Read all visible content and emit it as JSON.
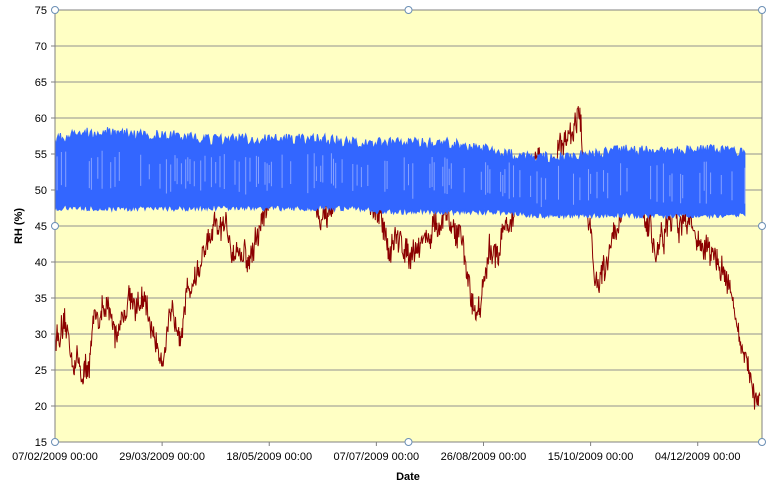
{
  "chart_data": {
    "type": "line",
    "title": "",
    "xlabel": "Date",
    "ylabel": "RH (%)",
    "ylim": [
      15,
      75
    ],
    "y_ticks": [
      15,
      20,
      25,
      30,
      35,
      40,
      45,
      50,
      55,
      60,
      65,
      70,
      75
    ],
    "x_range": [
      "2009-02-07",
      "2010-01-03"
    ],
    "x_ticks": [
      {
        "date": "2009-02-07",
        "label": "07/02/2009 00:00"
      },
      {
        "date": "2009-03-29",
        "label": "29/03/2009 00:00"
      },
      {
        "date": "2009-05-18",
        "label": "18/05/2009 00:00"
      },
      {
        "date": "2009-07-07",
        "label": "07/07/2009 00:00"
      },
      {
        "date": "2009-08-26",
        "label": "26/08/2009 00:00"
      },
      {
        "date": "2009-10-15",
        "label": "15/10/2009 00:00"
      },
      {
        "date": "2009-12-04",
        "label": "04/12/2009 00:00"
      }
    ],
    "grid": true,
    "plot_background": "#ffffc4",
    "series": [
      {
        "color": "#8b0000",
        "x": [
          "2009-02-07",
          "2009-02-14",
          "2009-02-21",
          "2009-02-28",
          "2009-03-07",
          "2009-03-14",
          "2009-03-21",
          "2009-03-28",
          "2009-04-04",
          "2009-04-11",
          "2009-04-18",
          "2009-04-25",
          "2009-05-02",
          "2009-05-09",
          "2009-05-16",
          "2009-05-23",
          "2009-05-30",
          "2009-06-06",
          "2009-06-13",
          "2009-06-20",
          "2009-06-27",
          "2009-07-04",
          "2009-07-11",
          "2009-07-18",
          "2009-07-25",
          "2009-08-01",
          "2009-08-08",
          "2009-08-15",
          "2009-08-22",
          "2009-08-29",
          "2009-09-05",
          "2009-09-12",
          "2009-09-19",
          "2009-09-26",
          "2009-10-03",
          "2009-10-10",
          "2009-10-17",
          "2009-10-24",
          "2009-10-31",
          "2009-11-07",
          "2009-11-14",
          "2009-11-21",
          "2009-11-28",
          "2009-12-05",
          "2009-12-12",
          "2009-12-19",
          "2009-12-26",
          "2010-01-02"
        ],
        "y": [
          30,
          28,
          24,
          34,
          30,
          36,
          33,
          28,
          31,
          37,
          41,
          44,
          43,
          40,
          47,
          53,
          54,
          51,
          44,
          50,
          52,
          47,
          44,
          42,
          43,
          44,
          45,
          44,
          33,
          40,
          45,
          47,
          53,
          52,
          58,
          60,
          38,
          42,
          50,
          48,
          42,
          45,
          47,
          43,
          40,
          38,
          24,
          22
        ]
      },
      {
        "color": "#3366ff",
        "x": [
          "2009-02-07",
          "2009-02-21",
          "2009-03-07",
          "2009-03-21",
          "2009-04-04",
          "2009-04-18",
          "2009-05-02",
          "2009-05-16",
          "2009-05-30",
          "2009-06-13",
          "2009-06-27",
          "2009-07-11",
          "2009-07-25",
          "2009-08-08",
          "2009-08-22",
          "2009-09-05",
          "2009-09-19",
          "2009-10-03",
          "2009-10-17",
          "2009-10-31",
          "2009-11-14",
          "2009-11-28",
          "2009-12-12",
          "2009-12-26"
        ],
        "y_low": [
          47.5,
          47.5,
          47.5,
          47.5,
          47.5,
          47.5,
          47.5,
          47.5,
          47.5,
          47.5,
          47.5,
          47,
          47,
          47,
          47,
          47,
          46.5,
          46.5,
          46.5,
          46.5,
          46.5,
          46.5,
          46.5,
          46.5
        ],
        "y_high": [
          57,
          58,
          58,
          57.5,
          57.5,
          57,
          57,
          57,
          57,
          57,
          56.5,
          56.5,
          56.5,
          56.5,
          56,
          55,
          54.5,
          54.5,
          55,
          55.5,
          55.5,
          55.5,
          55.5,
          55
        ]
      }
    ]
  }
}
